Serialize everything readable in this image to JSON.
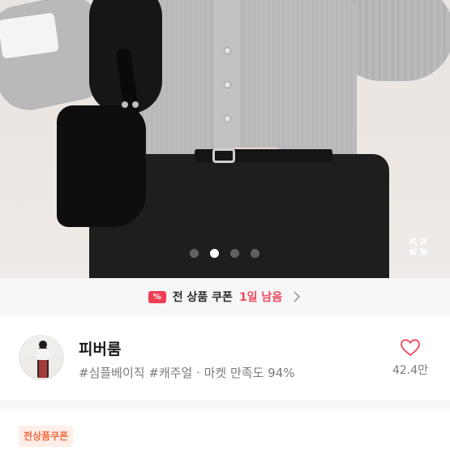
{
  "gallery": {
    "slide_count": 4,
    "active_index": 1,
    "expand_icon": "expand-icon"
  },
  "coupon_banner": {
    "icon": "coupon-icon",
    "text": "전 상품 쿠폰",
    "days_left": "1일 남음",
    "chevron": "chevron-right-icon",
    "accent_color": "#f0485e"
  },
  "shop": {
    "name": "피버룸",
    "tags": "#심플베이직 #캐주얼 · 마켓 만족도 94%",
    "like_icon": "heart-icon",
    "like_count": "42.4만",
    "like_color": "#f0485e"
  },
  "coupon_chip": {
    "label": "전상품쿠폰",
    "color": "#f06a3e"
  }
}
